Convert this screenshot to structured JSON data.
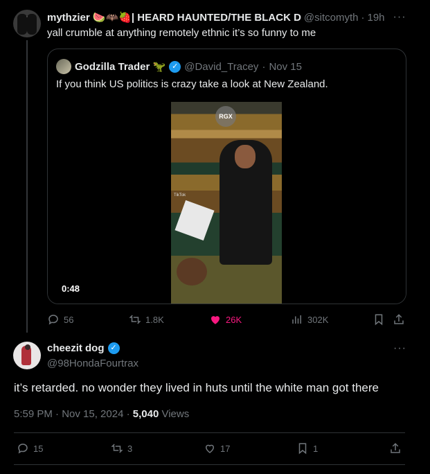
{
  "parent": {
    "name": "mythzier 🍉🦇🍓| HEARD HAUNTED/THE BLACK D",
    "handle": "@sitcomyth",
    "time": "19h",
    "text": "yall crumble at anything remotely ethnic it’s so funny to me"
  },
  "quote": {
    "name": "Godzilla Trader 🦖",
    "handle": "@David_Tracey",
    "time": "Nov 15",
    "text": "If you think US politics is crazy take a look at New Zealand.",
    "video": {
      "watermark": "RGX",
      "tiktok_label": "TikTok",
      "duration": "0:48"
    }
  },
  "parent_actions": {
    "replies": "56",
    "reposts": "1.8K",
    "likes": "26K",
    "views": "302K"
  },
  "reply": {
    "name": "cheezit dog",
    "handle": "@98HondaFourtrax",
    "text": "it’s retarded. no wonder they lived in huts until the white man got there",
    "time": "5:59 PM · Nov 15, 2024 ·",
    "views_count": "5,040",
    "views_label": "Views"
  },
  "reply_actions": {
    "replies": "15",
    "reposts": "3",
    "likes": "17",
    "bookmarks": "1"
  },
  "more_icon": "···",
  "colors": {
    "accent": "#1d9bf0",
    "like": "#f91880",
    "muted": "#71767b"
  }
}
